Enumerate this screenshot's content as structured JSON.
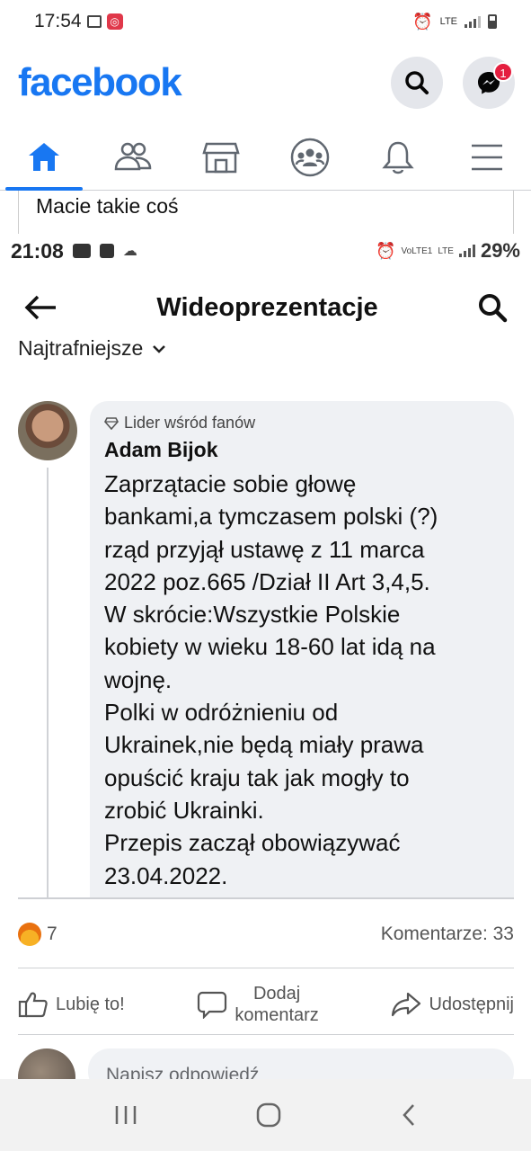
{
  "outer_status": {
    "time": "17:54",
    "net": "LTE"
  },
  "fb": {
    "logo": "facebook",
    "messenger_badge": "1"
  },
  "post": {
    "text": "Macie takie coś"
  },
  "inner_status": {
    "time": "21:08",
    "net1": "VoLTE1",
    "net2": "LTE",
    "battery": "29%"
  },
  "inner_header": {
    "title": "Wideoprezentacje",
    "sort_label": "Najtrafniejsze"
  },
  "comment": {
    "badge": "Lider wśród fanów",
    "author": "Adam Bijok",
    "lines": [
      "Zaprzątacie sobie głowę",
      "bankami,a tymczasem polski (?)",
      "rząd przyjął ustawę z 11 marca",
      "2022 poz.665 /Dział II Art 3,4,5.",
      "W skrócie:Wszystkie Polskie",
      "kobiety w wieku 18-60 lat idą na",
      "wojnę.",
      "Polki w odróżnieniu od",
      "Ukrainek,nie będą miały prawa",
      "opuścić kraju tak jak mogły to",
      "zrobić Ukrainki.",
      "Przepis zaczął obowiązywać",
      "23.04.2022."
    ]
  },
  "reactions": {
    "count": "7",
    "comments": "Komentarze: 33"
  },
  "actions": {
    "like": "Lubię to!",
    "comment_line1": "Dodaj",
    "comment_line2": "komentarz",
    "share": "Udostępnij"
  },
  "reply": {
    "placeholder": "Napisz odpowiedź"
  }
}
